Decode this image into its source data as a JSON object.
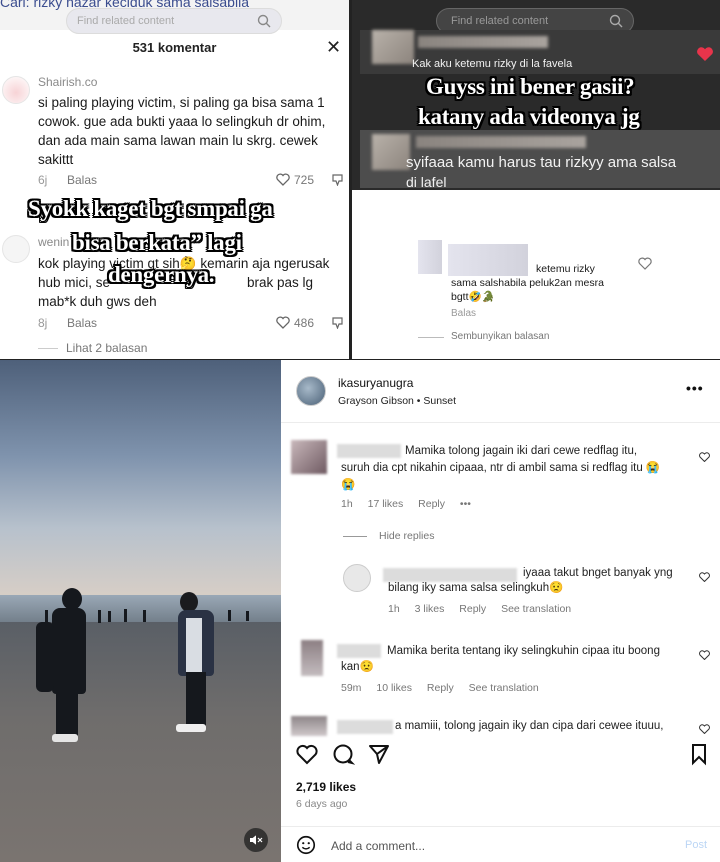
{
  "panel1": {
    "search_query": "Cari: rizky nazar keciduk sama salsabila",
    "search_placeholder": "Find related content",
    "title": "531 komentar",
    "close_symbol": "✕",
    "comment1": {
      "user": "Shairish.co",
      "text": "si paling playing victim, si paling ga bisa sama 1 cowok. gue ada bukti yaaa lo selingkuh dr ohim, dan ada main sama lawan main lu skrg. cewek sakittt",
      "time": "6j",
      "reply": "Balas",
      "likes": "725"
    },
    "overlay_lines": [
      "Syokk kaget bgt smpai ga",
      "bisa berkata” lagi",
      "dengernya."
    ],
    "comment2": {
      "user": "wenin",
      "text_line1": "kok playing victim gt sih🤔 kemarin aja ngerusak",
      "text_line2": "hub mici, se",
      "text_line2b": "brak pas lg",
      "text_line3": "mab*k duh gws deh",
      "time": "8j",
      "reply": "Balas",
      "likes": "486"
    },
    "view_replies": "Lihat 2 balasan"
  },
  "panel2": {
    "search_placeholder": "Find related content",
    "banner1_text": "Kak aku ketemu rizky di la favela",
    "overlay_lines": [
      "Guyss ini bener gasii?",
      "katany ada videonya jg"
    ],
    "banner2_line1": "syifaaa kamu harus tau rizkyy ama salsa",
    "banner2_line2": "di lafel",
    "reply": {
      "line1": "ketemu rizky",
      "line2": "sama salshabila peluk2an mesra",
      "line3": "bgtt🤣🐊",
      "reply_label": "Balas",
      "hide": "Sembunyikan balasan"
    }
  },
  "panel4": {
    "username": "ikasuryanugra",
    "song": "Grayson Gibson • Sunset",
    "more": "•••",
    "comments": [
      {
        "line1": "Mamika tolong jagain iki dari cewe redflag itu,",
        "line2": "suruh dia cpt nikahin cipaaa, ntr di ambil sama si redflag itu 😭",
        "line3": "😭",
        "time": "1h",
        "likes": "17 likes",
        "reply": "Reply",
        "more": "•••"
      },
      {
        "hide": "Hide replies"
      },
      {
        "line1": "iyaaa takut bnget banyak yng",
        "line2": "bilang iky sama salsa selingkuh😟",
        "time": "1h",
        "likes": "3 likes",
        "reply": "Reply",
        "translate": "See translation"
      },
      {
        "line1": "Mamika berita tentang iky selingkuhin cipaa itu boong",
        "line2": "kan😟",
        "time": "59m",
        "likes": "10 likes",
        "reply": "Reply",
        "translate": "See translation"
      },
      {
        "line1": "a mamiii, tolong jagain iky dan cipa dari cewee ituuu,"
      }
    ],
    "likes_count": "2,719 likes",
    "ago": "6 days ago",
    "add_comment": "Add a comment...",
    "post": "Post"
  },
  "colors": {
    "accent_blue": "#3b4d8f",
    "overlay_text": "#ffffff",
    "heart_red": "#e8344b",
    "ig_post_blue": "#bcd6f5"
  }
}
